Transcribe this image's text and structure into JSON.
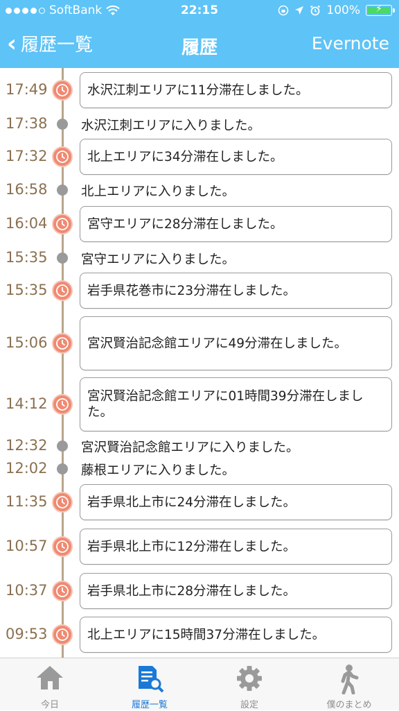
{
  "status": {
    "carrier": "SoftBank",
    "time": "22:15",
    "battery": "100%",
    "signal_icon": "signal-dots-icon",
    "wifi_icon": "wifi-icon"
  },
  "nav": {
    "back_label": "履歴一覧",
    "title": "履歴",
    "right_label": "Evernote"
  },
  "colors": {
    "header": "#5ec3f7",
    "clock": "#ef8a72",
    "timeline": "#b8a48c",
    "tab_active": "#1a78d6"
  },
  "timeline": [
    {
      "time": "17:49",
      "type": "stay",
      "text": "水沢江刺エリアに11分滞在しました。"
    },
    {
      "time": "17:38",
      "type": "enter",
      "text": "水沢江刺エリアに入りました。"
    },
    {
      "time": "17:32",
      "type": "stay",
      "text": "北上エリアに34分滞在しました。"
    },
    {
      "time": "16:58",
      "type": "enter",
      "text": "北上エリアに入りました。"
    },
    {
      "time": "16:04",
      "type": "stay",
      "text": "宮守エリアに28分滞在しました。"
    },
    {
      "time": "15:35",
      "type": "enter",
      "text": "宮守エリアに入りました。"
    },
    {
      "time": "15:35",
      "type": "stay",
      "text": "岩手県花巻市に23分滞在しました。"
    },
    {
      "time": "15:06",
      "type": "stay",
      "text": "宮沢賢治記念館エリアに49分滞在しました。"
    },
    {
      "time": "14:12",
      "type": "stay",
      "text": "宮沢賢治記念館エリアに01時間39分滞在しました。"
    },
    {
      "time": "12:32",
      "type": "enter",
      "text": "宮沢賢治記念館エリアに入りました。"
    },
    {
      "time": "12:02",
      "type": "enter",
      "text": "藤根エリアに入りました。"
    },
    {
      "time": "11:35",
      "type": "stay",
      "text": "岩手県北上市に24分滞在しました。"
    },
    {
      "time": "10:57",
      "type": "stay",
      "text": "岩手県北上市に12分滞在しました。"
    },
    {
      "time": "10:37",
      "type": "stay",
      "text": "岩手県北上市に28分滞在しました。"
    },
    {
      "time": "09:53",
      "type": "stay",
      "text": "北上エリアに15時間37分滞在しました。"
    }
  ],
  "tabs": [
    {
      "label": "今日",
      "icon": "home-icon",
      "active": false
    },
    {
      "label": "履歴一覧",
      "icon": "history-list-icon",
      "active": true
    },
    {
      "label": "設定",
      "icon": "gear-icon",
      "active": false
    },
    {
      "label": "僕のまとめ",
      "icon": "walking-person-icon",
      "active": false
    }
  ]
}
